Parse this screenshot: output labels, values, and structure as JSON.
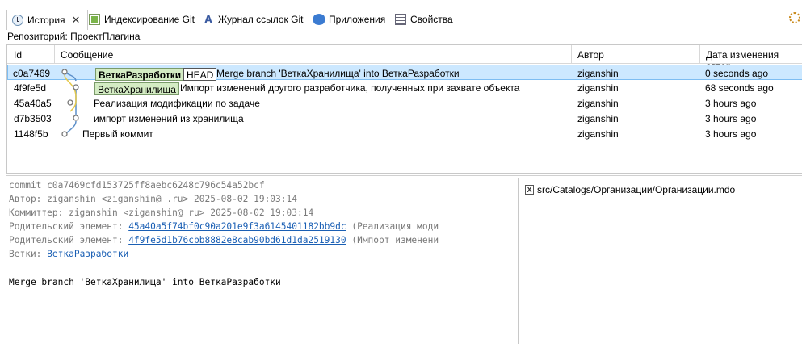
{
  "tabs": [
    {
      "label": "История",
      "icon": "history-icon",
      "active": true
    },
    {
      "label": "Индексирование Git",
      "icon": "git-staging-icon"
    },
    {
      "label": "Журнал ссылок Git",
      "icon": "reflog-icon"
    },
    {
      "label": "Приложения",
      "icon": "applications-icon"
    },
    {
      "label": "Свойства",
      "icon": "properties-icon"
    }
  ],
  "repository_line": "Репозиторий: ПроектПлагина",
  "table": {
    "columns": [
      "Id",
      "Сообщение",
      "Автор",
      "Дата изменения автор"
    ],
    "rows": [
      {
        "id": "c0a7469",
        "badges": [
          "ВеткаРазработки",
          "HEAD"
        ],
        "message": "Merge branch 'ВеткаХранилища' into ВеткаРазработки",
        "author": "ziganshin",
        "date": "0 seconds ago",
        "selected": true
      },
      {
        "id": "4f9fe5d",
        "badges": [
          "ВеткаХранилища"
        ],
        "message": "Импорт изменений другого разработчика, полученных при захвате объекта",
        "author": "ziganshin",
        "date": "68 seconds ago"
      },
      {
        "id": "45a40a5",
        "badges": [],
        "message": "Реализация модификации по задаче",
        "author": "ziganshin",
        "date": "3 hours ago"
      },
      {
        "id": "d7b3503",
        "badges": [],
        "message": "импорт изменений из хранилища",
        "author": "ziganshin",
        "date": "3 hours ago"
      },
      {
        "id": "1148f5b",
        "badges": [],
        "message": "Первый коммит",
        "author": "ziganshin",
        "date": "3 hours ago"
      }
    ]
  },
  "details": {
    "commit_line": "commit c0a7469cfd153725ff8aebc6248c796c54a52bcf",
    "author_line": "Автор: ziganshin <ziganshin@            .ru> 2025-08-02 19:03:14",
    "committer_line": "Коммиттер: ziganshin <ziganshin@            ru> 2025-08-02 19:03:14",
    "parent1_label": "Родительский элемент: ",
    "parent1_hash": "45a40a5f74bf0c90a201e9f3a6145401182bb9dc",
    "parent1_desc": " (Реализация моди",
    "parent2_label": "Родительский элемент: ",
    "parent2_hash": "4f9fe5d1b76cbb8882e8cab90bd61d1da2519130",
    "parent2_desc": " (Импорт изменени",
    "branches_label": "Ветки: ",
    "branches_link": "ВеткаРазработки",
    "message": "Merge branch 'ВеткаХранилища' into ВеткаРазработки"
  },
  "files": [
    "src/Catalogs/Организации/Организации.mdo"
  ],
  "colors": {
    "selection": "#cce8ff",
    "branch_badge": "#d4ecc4",
    "link": "#1a5fb4",
    "graph_blue": "#5b8fc9",
    "graph_yellow": "#e5c84a"
  }
}
